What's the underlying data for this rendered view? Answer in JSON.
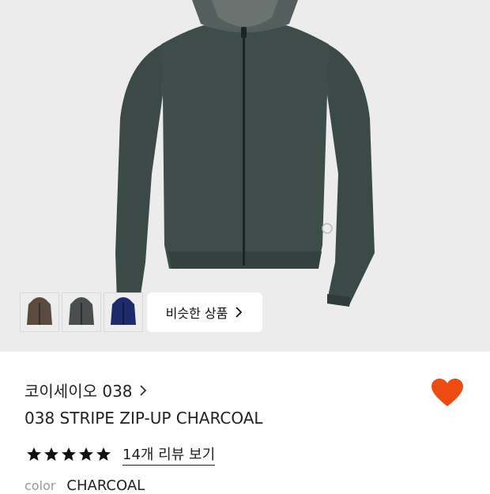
{
  "product_image": {
    "colors": {
      "body": "#3b4a47",
      "hood": "#545e5c",
      "hood_inner": "#6a7370",
      "zip": "#1c2423"
    }
  },
  "variants": [
    {
      "name": "brown",
      "color": "#5a4a40"
    },
    {
      "name": "charcoal",
      "color": "#4b4e4e"
    },
    {
      "name": "navy",
      "color": "#1f2a6b"
    }
  ],
  "similar_button": {
    "label": "비슷한 상품"
  },
  "brand": {
    "name": "코이세이오 038"
  },
  "wishlist": {
    "active": true,
    "color": "#ee4b12"
  },
  "product": {
    "title": "038 STRIPE ZIP-UP CHARCOAL"
  },
  "rating": {
    "stars": 5,
    "max_stars": 5,
    "review_link": "14개 리뷰 보기"
  },
  "color_option": {
    "label": "color",
    "value": "CHARCOAL"
  }
}
